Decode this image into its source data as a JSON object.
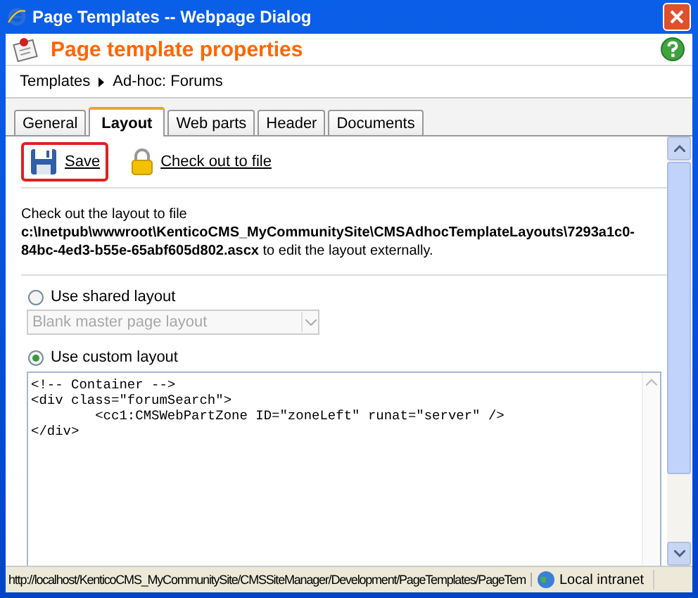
{
  "window": {
    "title": "Page Templates -- Webpage Dialog"
  },
  "header": {
    "title": "Page template properties"
  },
  "breadcrumb": [
    "Templates",
    "Ad-hoc: Forums"
  ],
  "tabs": [
    {
      "label": "General",
      "selected": false
    },
    {
      "label": "Layout",
      "selected": true
    },
    {
      "label": "Web parts",
      "selected": false
    },
    {
      "label": "Header",
      "selected": false
    },
    {
      "label": "Documents",
      "selected": false
    }
  ],
  "toolbar": [
    {
      "label": "Save",
      "kind": "save",
      "highlighted": true
    },
    {
      "label": "Check out to file",
      "kind": "lock",
      "highlighted": false
    }
  ],
  "info": "Check out the layout to file\n**c:\\Inetpub\\wwwroot\\KenticoCMS_MyCommunitySite\\CMSAdhocTemplateLayouts\\7293a1c0-84bc-4ed3-b55e-65abf605d802.ascx** to edit the layout externally.",
  "layout_options": [
    {
      "label": "Use shared layout",
      "selected": false
    },
    {
      "label": "Use custom layout",
      "selected": true
    }
  ],
  "shared_layout_select": {
    "value": "Blank master page layout",
    "disabled": true
  },
  "custom_layout_code": [
    "<!-- Container -->",
    "<div class=\"forumSearch\">",
    "        <cc1:CMSWebPartZone ID=\"zoneLeft\" runat=\"server\" />",
    "</div>"
  ],
  "status_bar": {
    "url": "http://localhost/KenticoCMS_MyCommunitySite/CMSSiteManager/Development/PageTemplates/PageTem",
    "zone": "Local intranet"
  }
}
